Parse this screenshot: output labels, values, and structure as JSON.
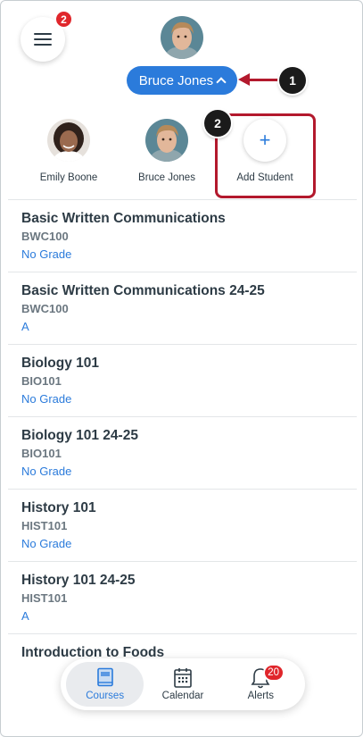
{
  "header": {
    "menu_badge": "2",
    "selected_student": "Bruce Jones"
  },
  "callouts": {
    "one": "1",
    "two": "2"
  },
  "students": [
    {
      "name": "Emily Boone"
    },
    {
      "name": "Bruce Jones"
    }
  ],
  "add_student": {
    "icon": "+",
    "label": "Add Student"
  },
  "courses": [
    {
      "name": "Basic Written Communications",
      "code": "BWC100",
      "grade": "No Grade"
    },
    {
      "name": "Basic Written Communications 24-25",
      "code": "BWC100",
      "grade": "A"
    },
    {
      "name": "Biology 101",
      "code": "BIO101",
      "grade": "No Grade"
    },
    {
      "name": "Biology 101 24-25",
      "code": "BIO101",
      "grade": "No Grade"
    },
    {
      "name": "History 101",
      "code": "HIST101",
      "grade": "No Grade"
    },
    {
      "name": "History 101 24-25",
      "code": "HIST101",
      "grade": "A"
    },
    {
      "name": "Introduction to Foods",
      "code": "",
      "grade": ""
    }
  ],
  "nav": {
    "courses": "Courses",
    "calendar": "Calendar",
    "alerts": "Alerts",
    "alerts_badge": "20"
  },
  "colors": {
    "accent": "#2b7bdb",
    "badge": "#e0262b",
    "callout": "#b3192d"
  }
}
